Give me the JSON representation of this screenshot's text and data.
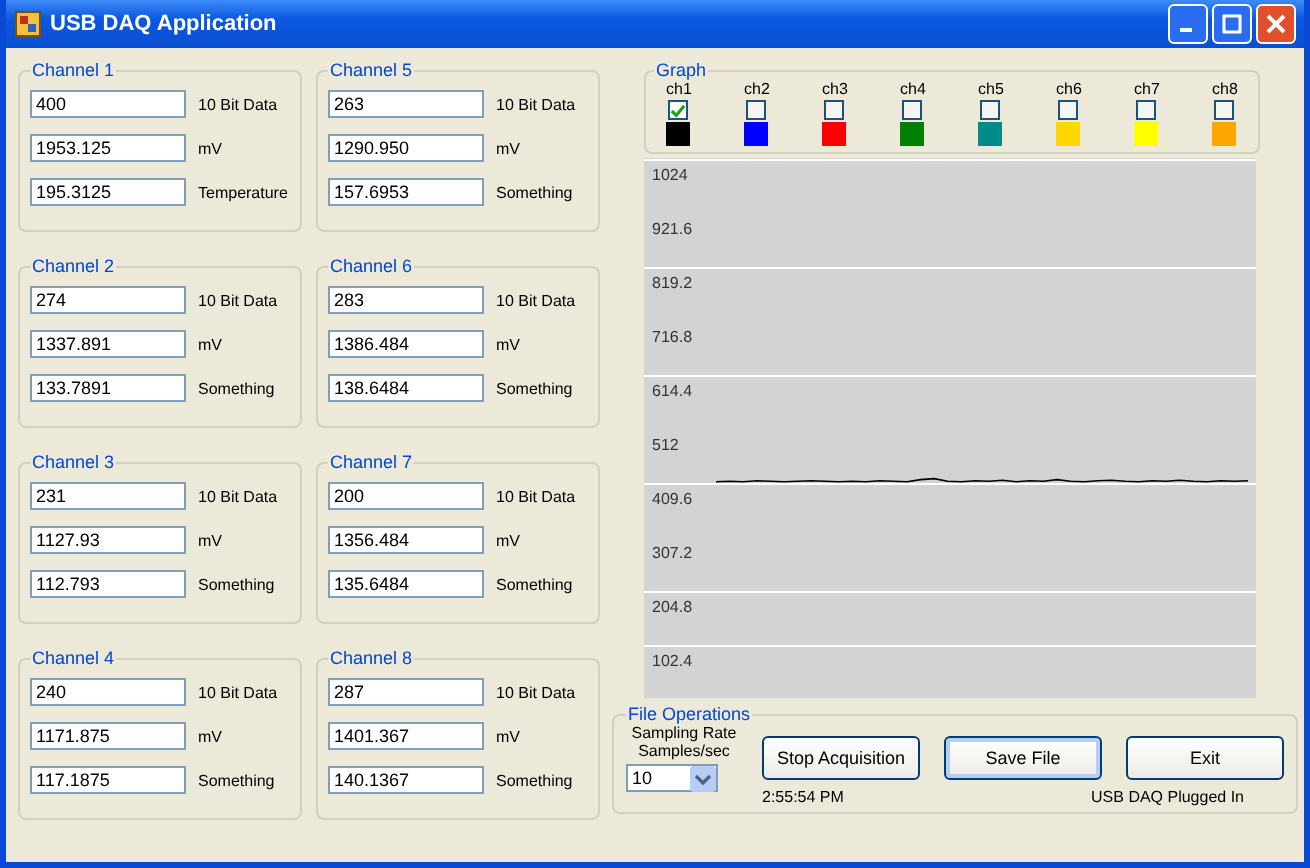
{
  "window": {
    "title": "USB DAQ Application"
  },
  "channels": [
    {
      "title": "Channel 1",
      "fields": [
        {
          "value": "400",
          "label": "10 Bit Data"
        },
        {
          "value": "1953.125",
          "label": "mV"
        },
        {
          "value": "195.3125",
          "label": "Temperature"
        }
      ]
    },
    {
      "title": "Channel 5",
      "fields": [
        {
          "value": "263",
          "label": "10 Bit Data"
        },
        {
          "value": "1290.950",
          "label": "mV"
        },
        {
          "value": "157.6953",
          "label": "Something"
        }
      ]
    },
    {
      "title": "Channel 2",
      "fields": [
        {
          "value": "274",
          "label": "10 Bit Data"
        },
        {
          "value": "1337.891",
          "label": "mV"
        },
        {
          "value": "133.7891",
          "label": "Something"
        }
      ]
    },
    {
      "title": "Channel 6",
      "fields": [
        {
          "value": "283",
          "label": "10 Bit Data"
        },
        {
          "value": "1386.484",
          "label": "mV"
        },
        {
          "value": "138.6484",
          "label": "Something"
        }
      ]
    },
    {
      "title": "Channel 3",
      "fields": [
        {
          "value": "231",
          "label": "10 Bit Data"
        },
        {
          "value": "1127.93",
          "label": "mV"
        },
        {
          "value": "112.793",
          "label": "Something"
        }
      ]
    },
    {
      "title": "Channel 7",
      "fields": [
        {
          "value": "200",
          "label": "10 Bit Data"
        },
        {
          "value": "1356.484",
          "label": "mV"
        },
        {
          "value": "135.6484",
          "label": "Something"
        }
      ]
    },
    {
      "title": "Channel 4",
      "fields": [
        {
          "value": "240",
          "label": "10 Bit Data"
        },
        {
          "value": "1171.875",
          "label": "mV"
        },
        {
          "value": "117.1875",
          "label": "Something"
        }
      ]
    },
    {
      "title": "Channel 8",
      "fields": [
        {
          "value": "287",
          "label": "10 Bit Data"
        },
        {
          "value": "1401.367",
          "label": "mV"
        },
        {
          "value": "140.1367",
          "label": "Something"
        }
      ]
    }
  ],
  "graph": {
    "title": "Graph",
    "selectors": [
      {
        "label": "ch1",
        "checked": true,
        "color": "#000000"
      },
      {
        "label": "ch2",
        "checked": false,
        "color": "#0000ff"
      },
      {
        "label": "ch3",
        "checked": false,
        "color": "#ff0000"
      },
      {
        "label": "ch4",
        "checked": false,
        "color": "#008000"
      },
      {
        "label": "ch5",
        "checked": false,
        "color": "#008b8b"
      },
      {
        "label": "ch6",
        "checked": false,
        "color": "#ffd700"
      },
      {
        "label": "ch7",
        "checked": false,
        "color": "#ffff00"
      },
      {
        "label": "ch8",
        "checked": false,
        "color": "#ffa500"
      }
    ],
    "chart_data": {
      "type": "line",
      "ylim": [
        0,
        1024
      ],
      "yticks": [
        102.4,
        204.8,
        307.2,
        409.6,
        512,
        614.4,
        716.8,
        819.2,
        921.6,
        1024
      ],
      "grid": true,
      "series": [
        {
          "color": "#000000",
          "values": [
            410,
            411,
            410,
            412,
            411,
            410,
            411,
            412,
            411,
            410,
            411,
            410,
            412,
            411,
            410,
            414,
            416,
            411,
            410,
            412,
            411,
            413,
            410,
            412,
            411,
            414,
            411,
            410,
            412,
            413,
            411,
            410,
            412,
            411,
            413,
            411,
            410,
            412,
            411,
            412
          ]
        }
      ]
    }
  },
  "file_operations": {
    "title": "File Operations",
    "rate_label": "Sampling Rate Samples/sec",
    "rate_value": "10",
    "buttons": [
      "Stop Acquisition",
      "Save File",
      "Exit"
    ],
    "time": "2:55:54 PM",
    "status": "USB DAQ Plugged In"
  }
}
